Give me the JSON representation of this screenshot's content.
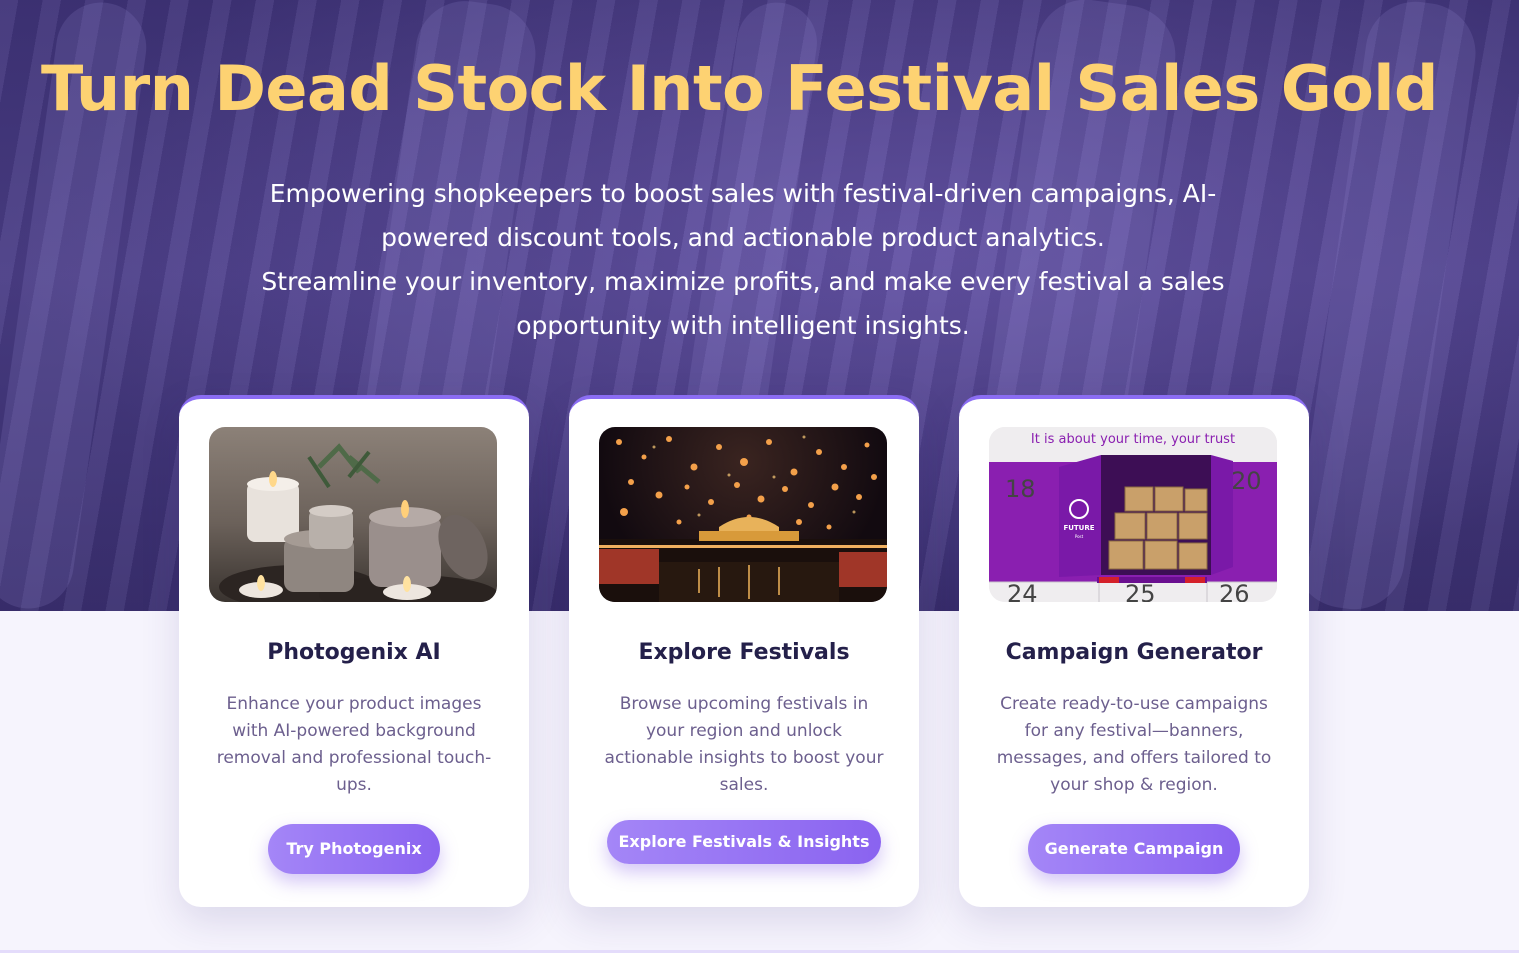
{
  "hero": {
    "title": "Turn Dead Stock Into Festival Sales Gold",
    "subtitle_line1": "Empowering shopkeepers to boost sales with festival-driven campaigns, AI-",
    "subtitle_line2": "powered discount tools, and actionable product analytics.",
    "subtitle_line3": "Streamline your inventory, maximize profits, and make every festival a sales",
    "subtitle_line4": "opportunity with intelligent insights."
  },
  "cards": [
    {
      "title": "Photogenix AI",
      "description": "Enhance your product images with AI-powered background removal and professional touch-ups.",
      "button": "Try Photogenix",
      "image": "candles-photo"
    },
    {
      "title": "Explore Festivals",
      "description": "Browse upcoming festivals in your region and unlock actionable insights to boost your sales.",
      "button": "Explore Festivals & Insights",
      "image": "sky-lanterns-photo"
    },
    {
      "title": "Campaign Generator",
      "description": "Create ready-to-use campaigns for any festival—banners, messages, and offers tailored to your shop & region.",
      "button": "Generate Campaign",
      "image": "delivery-truck-calendar-ad",
      "image_text": {
        "tagline": "It is about your time, your trust",
        "brand": "FUTURE",
        "brand_sub": "Post",
        "dates": [
          "18",
          "20",
          "24",
          "25",
          "26"
        ]
      }
    }
  ],
  "colors": {
    "title_gold": "#fdd272",
    "accent_purple": "#8a63f0",
    "hero_bg": "#43367c",
    "card_title": "#24204a",
    "card_text": "#6c5f8e"
  }
}
